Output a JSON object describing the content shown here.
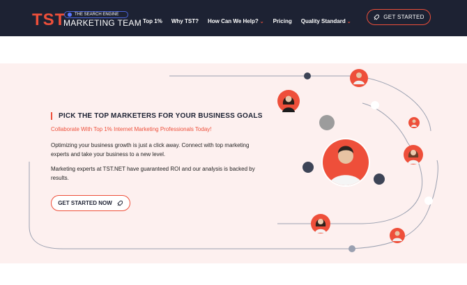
{
  "header": {
    "logo_mark": "TST",
    "logo_tagline": "THE SEARCH ENGINE",
    "logo_name": "MARKETING TEAM",
    "nav": [
      {
        "label": "Top 1%"
      },
      {
        "label": "Why TST?"
      },
      {
        "label": "How Can We Help?",
        "chevron": true
      },
      {
        "label": "Pricing"
      },
      {
        "label": "Quality Standard",
        "chevron": true
      }
    ],
    "cta_label": "GET STARTED"
  },
  "hero": {
    "title": "PICK THE TOP MARKETERS FOR YOUR BUSINESS GOALS",
    "subtitle": "Collaborate With Top 1% Internet Marketing Professionals Today!",
    "paragraph1": "Optimizing your business growth is just a click away. Connect with top marketing experts and take your business to a new level.",
    "paragraph2": "Marketing experts at TST.NET have guaranteed ROI and our analysis is backed by results.",
    "cta_label": "GET STARTED NOW"
  },
  "colors": {
    "header_bg": "#1d2233",
    "accent": "#ee4f3a",
    "hero_bg": "#fdf0ef",
    "dot_dark": "#3d4456",
    "dot_grey": "#9c9c9c"
  },
  "icons": {
    "cta": "rocket-icon",
    "chevron": "chevron-down-icon"
  }
}
